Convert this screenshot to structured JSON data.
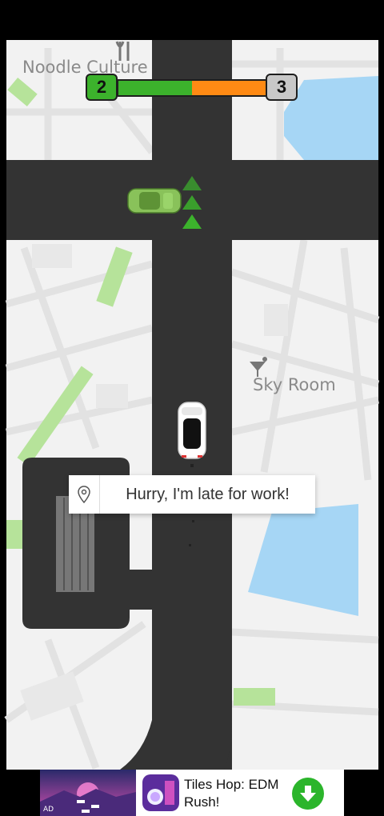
{
  "map": {
    "poi_noodle": "Noodle Culture",
    "poi_sky": "Sky Room"
  },
  "progress": {
    "current_level": "2",
    "next_level": "3",
    "completed_fraction": 0.5,
    "colors": {
      "done": "#3cb22c",
      "remaining": "#ff8a14",
      "current_box": "#3cb22c",
      "next_box": "#c8c8c8"
    }
  },
  "toast": {
    "message": "Hurry, I'm late for work!",
    "icon": "location-pin-icon"
  },
  "ad": {
    "tag": "AD",
    "title": "Tiles Hop: EDM Rush!",
    "action_icon": "download-arrow-icon"
  },
  "colors": {
    "road": "#333333",
    "map_bg": "#f2f2f2",
    "water": "#a6d6f5",
    "park": "#b6e39a"
  }
}
